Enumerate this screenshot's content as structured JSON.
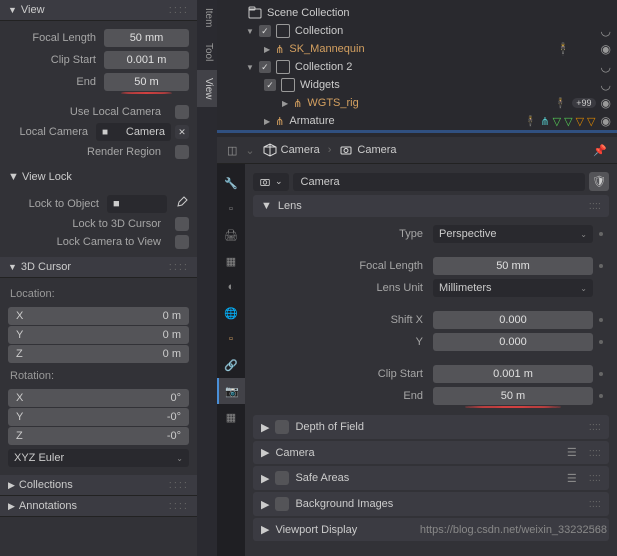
{
  "left": {
    "view": {
      "title": "View",
      "focal_length_label": "Focal Length",
      "focal_length": "50 mm",
      "clip_start_label": "Clip Start",
      "clip_start": "0.001 m",
      "end_label": "End",
      "end": "50 m",
      "use_local_camera_label": "Use Local Camera",
      "local_camera_label": "Local Camera",
      "local_camera": "Camera",
      "render_region_label": "Render Region"
    },
    "view_lock": {
      "title": "View Lock",
      "lock_object_label": "Lock to Object",
      "lock_3d_cursor_label": "Lock to 3D Cursor",
      "lock_camera_label": "Lock Camera to View"
    },
    "cursor": {
      "title": "3D Cursor",
      "location_label": "Location:",
      "rotation_label": "Rotation:",
      "x": "X",
      "y": "Y",
      "z": "Z",
      "loc_x": "0 m",
      "loc_y": "0 m",
      "loc_z": "0 m",
      "rot_x": "0°",
      "rot_y": "-0°",
      "rot_z": "-0°",
      "mode": "XYZ Euler"
    },
    "collections": "Collections",
    "annotations": "Annotations",
    "tabs": [
      "Item",
      "Tool",
      "View"
    ]
  },
  "outliner": {
    "root": "Scene Collection",
    "items": [
      {
        "name": "Collection",
        "indent": 1
      },
      {
        "name": "SK_Mannequin",
        "indent": 2,
        "color": "#d4a060"
      },
      {
        "name": "Collection 2",
        "indent": 1
      },
      {
        "name": "Widgets",
        "indent": 2
      },
      {
        "name": "WGTS_rig",
        "indent": 3,
        "color": "#d4a060",
        "badge": "+99"
      },
      {
        "name": "Armature",
        "indent": 2
      }
    ]
  },
  "breadcrumb": {
    "item1": "Camera",
    "item2": "Camera"
  },
  "props": {
    "search": "Camera",
    "lens": {
      "title": "Lens",
      "type_label": "Type",
      "type": "Perspective",
      "focal_length_label": "Focal Length",
      "focal_length": "50 mm",
      "lens_unit_label": "Lens Unit",
      "lens_unit": "Millimeters",
      "shift_x_label": "Shift X",
      "shift_x": "0.000",
      "shift_y_label": "Y",
      "shift_y": "0.000",
      "clip_start_label": "Clip Start",
      "clip_start": "0.001 m",
      "end_label": "End",
      "end": "50 m"
    },
    "sections": [
      "Depth of Field",
      "Camera",
      "Safe Areas",
      "Background Images",
      "Viewport Display"
    ]
  },
  "watermark": "https://blog.csdn.net/weixin_33232568"
}
